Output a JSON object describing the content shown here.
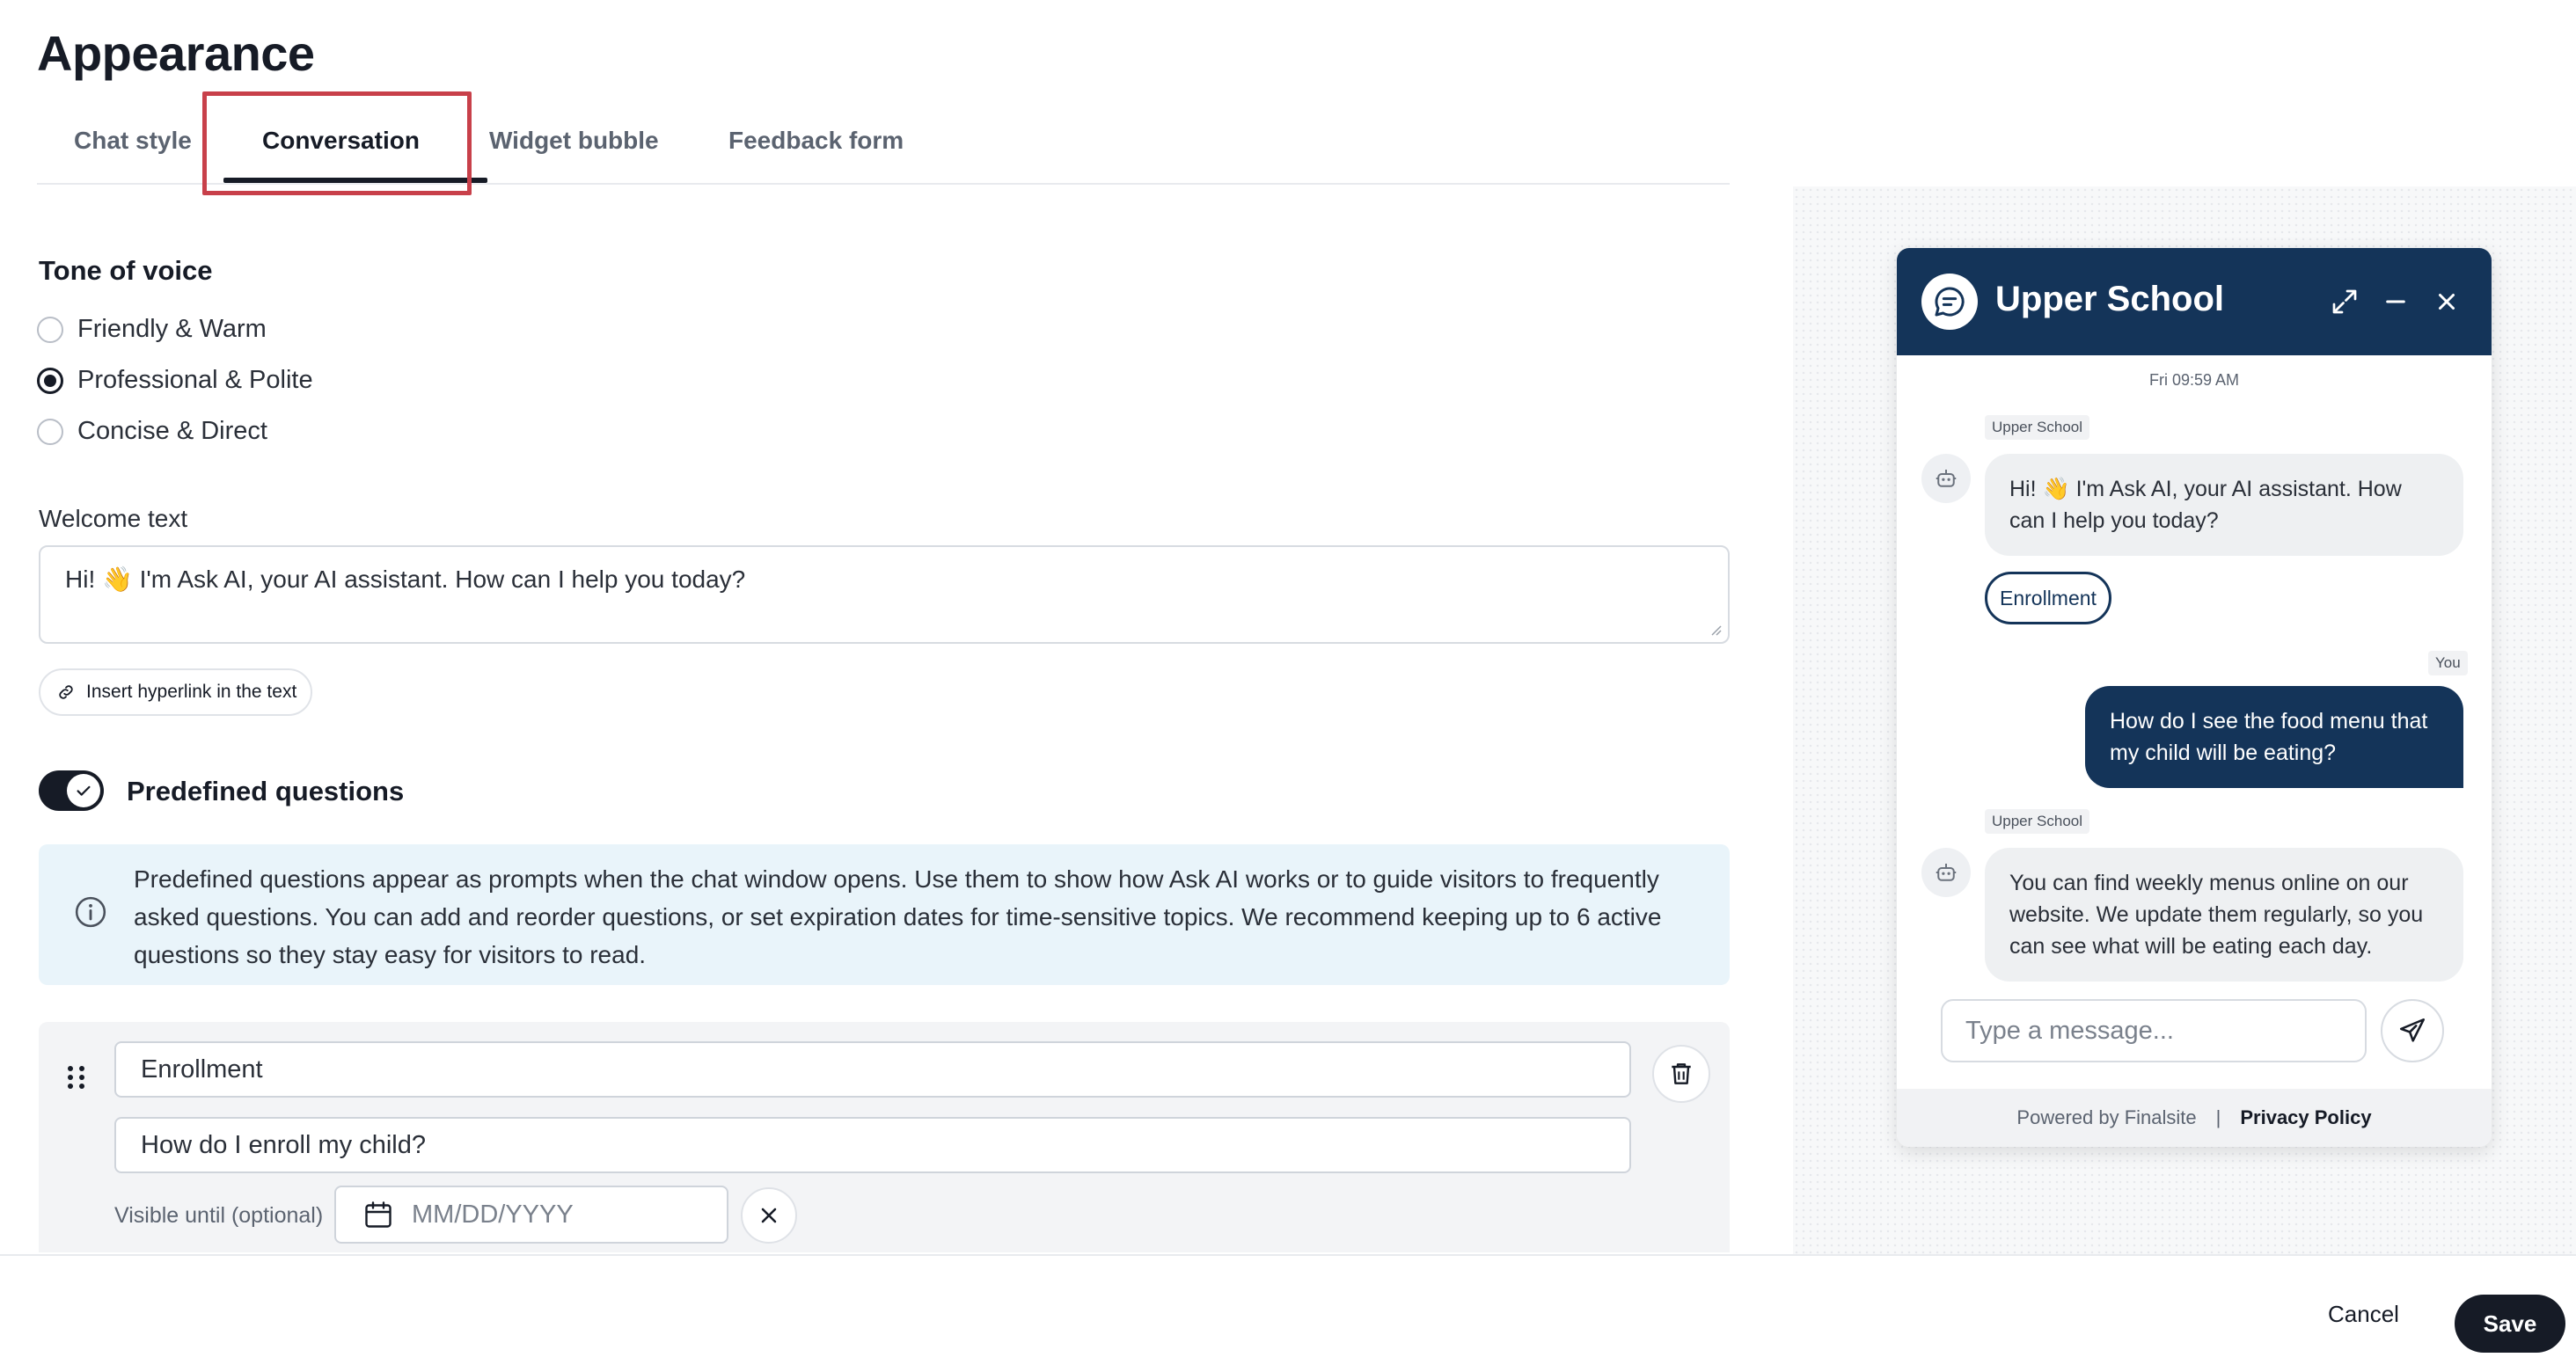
{
  "page": {
    "title": "Appearance"
  },
  "tabs": [
    {
      "label": "Chat style"
    },
    {
      "label": "Conversation",
      "active": true
    },
    {
      "label": "Widget bubble"
    },
    {
      "label": "Feedback form"
    }
  ],
  "tone": {
    "title": "Tone of voice",
    "options": [
      {
        "label": "Friendly & Warm",
        "checked": false
      },
      {
        "label": "Professional & Polite",
        "checked": true
      },
      {
        "label": "Concise & Direct",
        "checked": false
      }
    ]
  },
  "welcome": {
    "label": "Welcome text",
    "value": "Hi! 👋 I'm Ask AI, your AI assistant. How can I help you today?"
  },
  "hyperlink_button": {
    "label": "Insert hyperlink in the text",
    "icon": "link-icon"
  },
  "predefined": {
    "toggle_on": true,
    "title": "Predefined questions",
    "info": "Predefined questions appear as prompts when the chat window opens. Use them to show how Ask AI works or to guide visitors to frequently asked questions. You can add and reorder questions, or set expiration dates for time-sensitive topics. We recommend keeping up to 6 active questions so they stay easy for visitors to read.",
    "question": {
      "title_value": "Enrollment",
      "question_value": "How do I enroll my child?",
      "visible_label": "Visible until (optional)",
      "date_placeholder": "MM/DD/YYYY"
    }
  },
  "preview": {
    "title": "Upper School",
    "time": "Fri 09:59 AM",
    "bot_name": "Upper School",
    "user_name": "You",
    "messages": {
      "bot_1": "Hi! 👋 I'm Ask AI, your AI assistant. How can I help you today?",
      "quick_reply": "Enrollment",
      "user_1": "How do I see the food menu that my child will be eating?",
      "bot_2": "You can find weekly menus online on our website. We update them regularly, so you can see what will be eating each day."
    },
    "input_placeholder": "Type a message...",
    "footer": {
      "powered": "Powered by Finalsite",
      "divider": "|",
      "privacy": "Privacy Policy"
    },
    "header_color": "#143459"
  },
  "actions": {
    "cancel": "Cancel",
    "save": "Save"
  },
  "colors": {
    "primary": "#161b26",
    "highlight": "#c8404a",
    "info_bg": "#e9f4fa"
  }
}
